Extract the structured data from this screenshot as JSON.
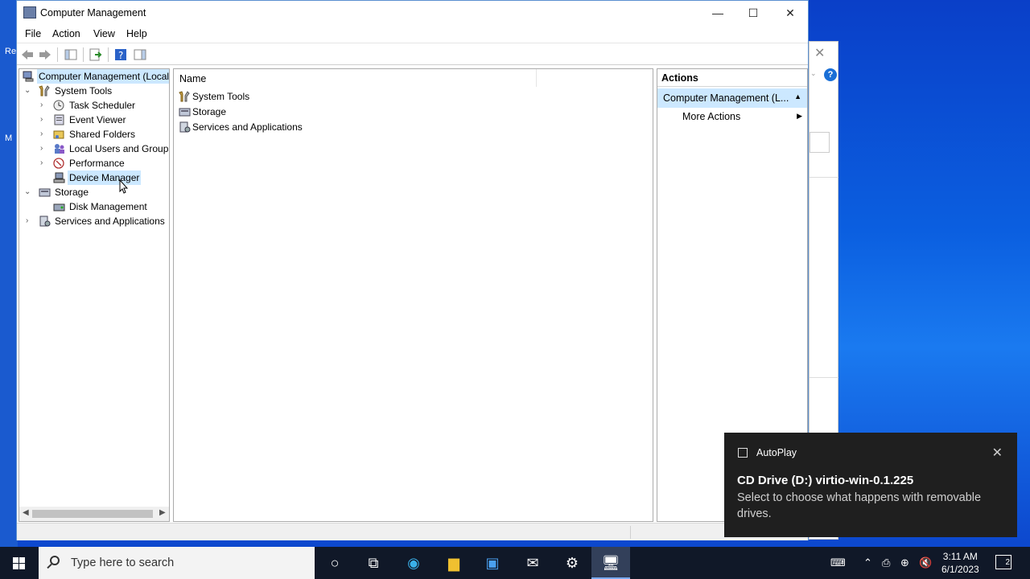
{
  "window": {
    "title": "Computer Management",
    "controls": {
      "minimize": "—",
      "maximize": "☐",
      "close": "✕"
    }
  },
  "menu": [
    "File",
    "Action",
    "View",
    "Help"
  ],
  "tree": {
    "root": "Computer Management (Local",
    "items": [
      {
        "label": "System Tools"
      },
      {
        "label": "Task Scheduler"
      },
      {
        "label": "Event Viewer"
      },
      {
        "label": "Shared Folders"
      },
      {
        "label": "Local Users and Groups"
      },
      {
        "label": "Performance"
      },
      {
        "label": "Device Manager"
      },
      {
        "label": "Storage"
      },
      {
        "label": "Disk Management"
      },
      {
        "label": "Services and Applications"
      }
    ]
  },
  "list": {
    "column_name": "Name",
    "rows": [
      "System Tools",
      "Storage",
      "Services and Applications"
    ]
  },
  "actions": {
    "header": "Actions",
    "group": "Computer Management (L...",
    "items": [
      "More Actions"
    ]
  },
  "toast": {
    "app": "AutoPlay",
    "title": "CD Drive (D:) virtio-win-0.1.225",
    "body": "Select to choose what happens with removable drives."
  },
  "taskbar": {
    "search_placeholder": "Type here to search",
    "time": "3:11 AM",
    "date": "6/1/2023",
    "notification_count": "2"
  },
  "desktop": {
    "partial_label_1": "Re",
    "partial_label_2": "M"
  }
}
